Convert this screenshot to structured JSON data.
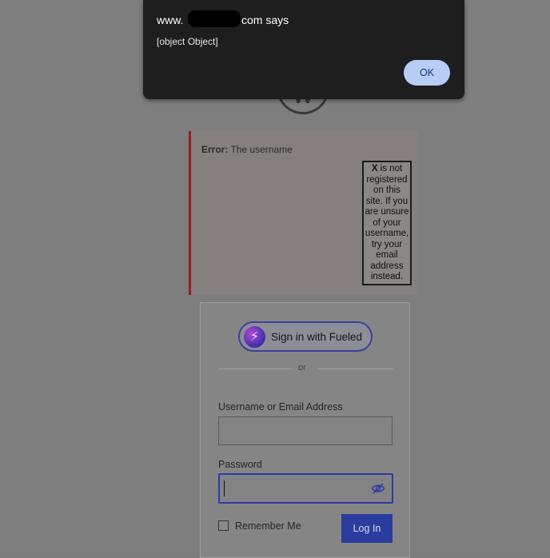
{
  "alert": {
    "title_prefix": "www.",
    "title_suffix": "com says",
    "message": "[object Object]",
    "ok_label": "OK"
  },
  "error": {
    "prefix": "Error:",
    "text": " The username",
    "injected_box": {
      "bold": "X",
      "text": " is not registered on this site. If you are unsure of your username, try your email address instead."
    }
  },
  "login": {
    "sso_label": "Sign in with Fueled",
    "divider_text": "or",
    "username_label": "Username or Email Address",
    "password_label": "Password",
    "remember_label": "Remember Me",
    "submit_label": "Log In"
  },
  "icons": {
    "logo": "wordpress-logo-icon",
    "sso": "fueled-logo-icon",
    "password_toggle": "eye-slash-icon"
  },
  "colors": {
    "dialog_bg": "#1e1e1e",
    "ok_button": "#b8cdf6",
    "error_border": "#9c1c1c",
    "primary_button": "#2c3b9e"
  }
}
